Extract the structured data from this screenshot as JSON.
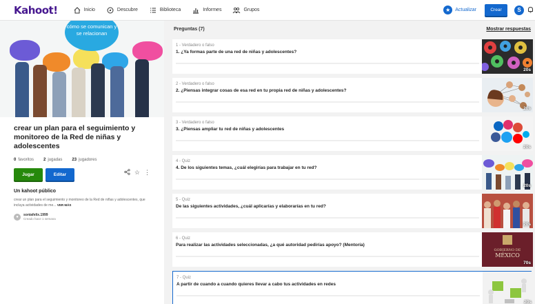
{
  "logo": "Kahoot!",
  "nav": [
    {
      "label": "Inicio",
      "icon": "home-icon"
    },
    {
      "label": "Descubre",
      "icon": "compass-icon"
    },
    {
      "label": "Biblioteca",
      "icon": "list-icon"
    },
    {
      "label": "Informes",
      "icon": "bar-chart-icon"
    },
    {
      "label": "Grupos",
      "icon": "group-icon"
    }
  ],
  "actions": {
    "upgrade": "Actualizar",
    "create": "Crear",
    "avatar": "S"
  },
  "cover": {
    "text": "cómo se comunican y se relacionan"
  },
  "kahoot": {
    "title": "crear un plan para el seguimiento y monitoreo de la Red de niñas y adolescentes",
    "favorites_count": "0",
    "favorites_label": "favoritos",
    "plays_count": "2",
    "plays_label": "jugadas",
    "players_count": "23",
    "players_label": "jugadores",
    "play_button": "Jugar",
    "edit_button": "Editar",
    "visibility": "Un kahoot público",
    "description": "crear un plan para el seguimiento y monitoreo de la Red de niñas y adolescentes, que incluya actividades de me...",
    "read_more": "VER MÁS",
    "author": "soniafelix.1999",
    "created": "Creado hace 1 semana"
  },
  "questions_header": {
    "count_label": "Preguntas (7)",
    "show_answers": "Mostrar respuestas"
  },
  "questions": [
    {
      "type": "1 - Verdadero o falso",
      "text": "1. ¿Ya formas parte de una red de niñas y adolescentes?",
      "time": "20s",
      "thumb_color": "#2b2b2b"
    },
    {
      "type": "2 - Verdadero o falso",
      "text": "2. ¿Piensas integrar cosas de esa red en tu propia red de niñas y adolescentes?",
      "time": "20s",
      "thumb_color": "#e9eef2"
    },
    {
      "type": "3 - Verdadero o falso",
      "text": "3. ¿Piensas ampliar tu red de niñas y adolescentes",
      "time": "20s",
      "thumb_color": "#f4f4f4"
    },
    {
      "type": "4 - Quiz",
      "text": "4. De los siguientes temas, ¿cuál elegirías para trabajar en tu red?",
      "time": "20s",
      "thumb_color": "#eef3f3"
    },
    {
      "type": "5 - Quiz",
      "text": "De las siguientes actividades, ¿cuál aplicarías y elaborarías en tu red?",
      "time": "20s",
      "thumb_color": "#c85a4a"
    },
    {
      "type": "6 - Quiz",
      "text": "Para realizar las actividades seleccionadas, ¿a qué autoridad pedirías apoyo? (Mentoría)",
      "time": "70s",
      "thumb_color": "#6b1f2a",
      "thumb_text_1": "GOBIERNO DE",
      "thumb_text_2": "MÉXICO"
    },
    {
      "type": "7 - Quiz",
      "text": "A partir de cuando a cuando quieres llevar a cabo tus actividades en redes",
      "time": "20s",
      "thumb_color": "#f2f2f2"
    }
  ]
}
